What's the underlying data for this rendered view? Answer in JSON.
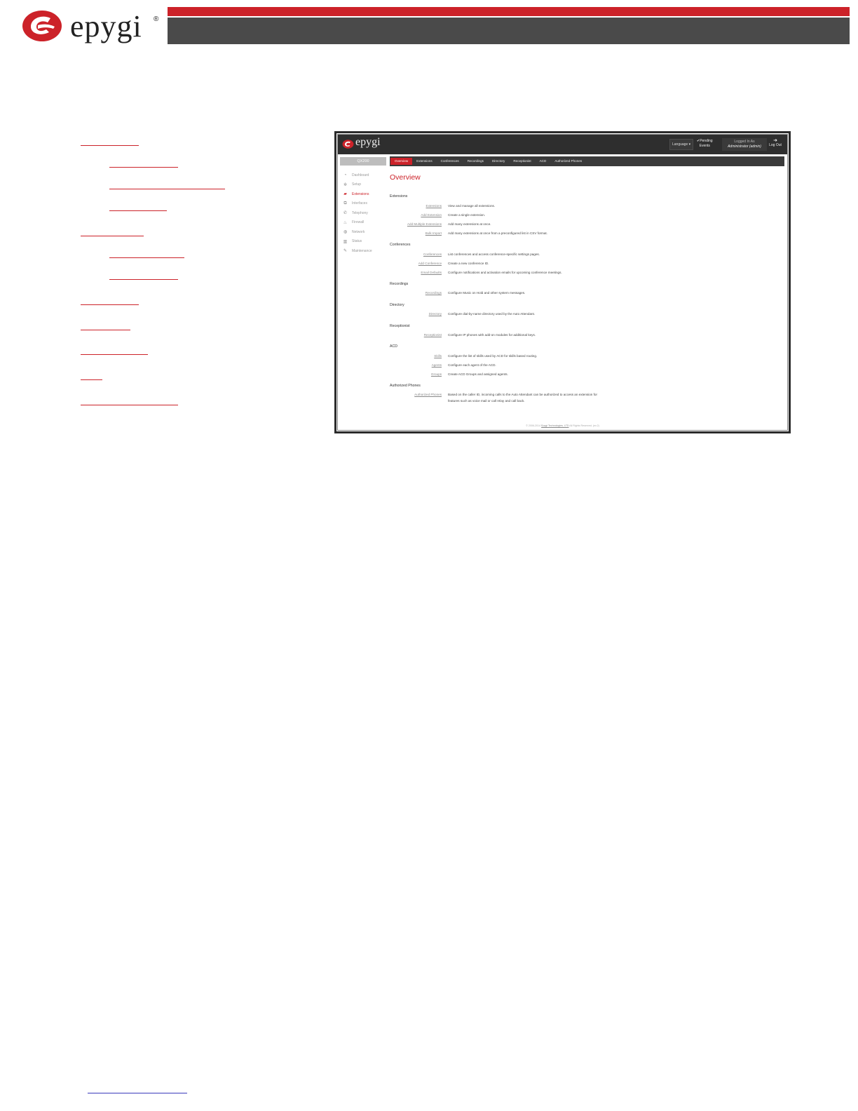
{
  "document": {
    "brand": "epygi",
    "registered": "®"
  },
  "app": {
    "brand": "epygi",
    "language_label": "Language ▾",
    "pending_events": [
      "✔Pending",
      "Events"
    ],
    "logged_in_label": "Logged In As",
    "logged_in_user": "Administrator (admin)",
    "logout_label": "Log Out",
    "device_name": "QX200",
    "tabs": [
      "Overview",
      "Extensions",
      "Conferences",
      "Recordings",
      "Directory",
      "Receptionist",
      "ACD",
      "Authorized Phones"
    ],
    "active_tab": "Overview",
    "sidebar": [
      {
        "label": "Dashboard",
        "icon": "dashboard-icon",
        "glyph": "◔"
      },
      {
        "label": "Setup",
        "icon": "gear-icon",
        "glyph": "✲"
      },
      {
        "label": "Extensions",
        "icon": "extensions-icon",
        "glyph": "▰"
      },
      {
        "label": "Interfaces",
        "icon": "interfaces-icon",
        "glyph": "⧉"
      },
      {
        "label": "Telephony",
        "icon": "phone-icon",
        "glyph": "✆"
      },
      {
        "label": "Firewall",
        "icon": "flame-icon",
        "glyph": "♨"
      },
      {
        "label": "Network",
        "icon": "globe-icon",
        "glyph": "◍"
      },
      {
        "label": "Status",
        "icon": "status-icon",
        "glyph": "▥"
      },
      {
        "label": "Maintenance",
        "icon": "wrench-icon",
        "glyph": "✎"
      }
    ],
    "page_title": "Overview",
    "sections": {
      "extensions": {
        "title": "Extensions",
        "rows": [
          {
            "link": "Extensions",
            "desc": "View and manage all extensions."
          },
          {
            "link": "Add Extension",
            "desc": "Create a single extension."
          },
          {
            "link": "Add Multiple Extensions",
            "desc": "Add many extensions at once."
          },
          {
            "link": "Bulk Import",
            "desc": "Add many extensions at once from a preconfigured list in CSV format."
          }
        ]
      },
      "conferences": {
        "title": "Conferences",
        "rows": [
          {
            "link": "Conferences",
            "desc": "List conferences and access conference-specific settings pages."
          },
          {
            "link": "Add Conference",
            "desc": "Create a new conference ID."
          },
          {
            "link": "Email Defaults",
            "desc": "Configure notifications and activation emails for upcoming conference meetings."
          }
        ]
      },
      "recordings": {
        "title": "Recordings",
        "rows": [
          {
            "link": "Recordings",
            "desc": "Configure Music on Hold and other system messages."
          }
        ]
      },
      "directory": {
        "title": "Directory",
        "rows": [
          {
            "link": "Directory",
            "desc": "Configure dial-by-name directory used by the Auto Attendant."
          }
        ]
      },
      "receptionist": {
        "title": "Receptionist",
        "rows": [
          {
            "link": "Receptionist",
            "desc": "Configure IP phones with add-on modules for additional keys."
          }
        ]
      },
      "acd": {
        "title": "ACD",
        "rows": [
          {
            "link": "Skills",
            "desc": "Configure the list of skills used by ACD for skills based routing."
          },
          {
            "link": "Agents",
            "desc": "Configure each agent of the ACD."
          },
          {
            "link": "Groups",
            "desc": "Create ACD Groups and assigned agents."
          }
        ]
      },
      "authorized_phones": {
        "title": "Authorized Phones",
        "rows": [
          {
            "link": "Authorized Phones",
            "desc": "Based on the caller ID, incoming calls to the Auto Attendant can be authorized to access an extension for",
            "desc2": "features such as voice mail or call relay and call back."
          }
        ]
      }
    },
    "copyright": {
      "prefix": "© 2006-2014",
      "company": "Epygi Technologies, LTD",
      "suffix": " All Rights Reserved. (ev.2)"
    }
  },
  "colors": {
    "brand_red": "#cc2229",
    "header_dark": "#4a4a4a",
    "app_topbar": "#2e2e2e",
    "footer_link": "#3b3bbb"
  }
}
